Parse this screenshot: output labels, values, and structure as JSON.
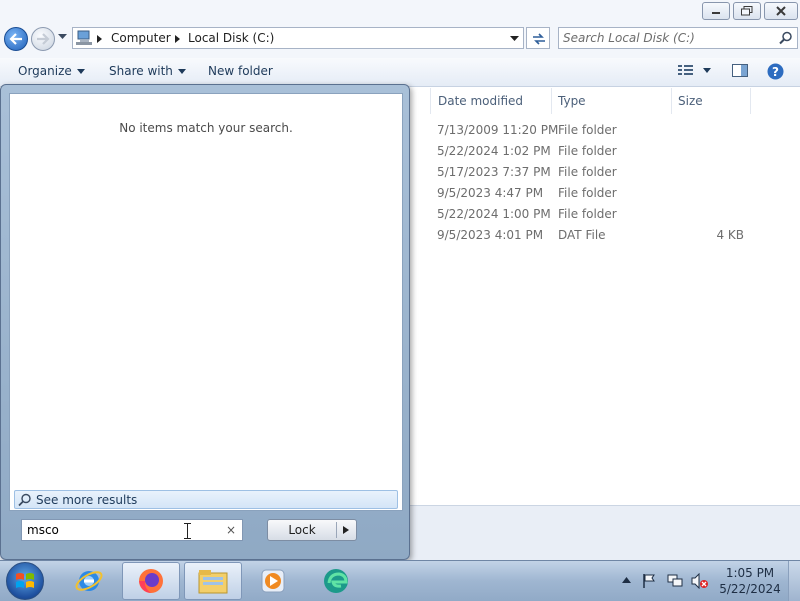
{
  "explorer": {
    "address": {
      "crumbs": [
        "Computer",
        "Local Disk (C:)"
      ]
    },
    "search": {
      "placeholder": "Search Local Disk (C:)"
    },
    "toolbar": {
      "organize_label": "Organize",
      "share_label": "Share with",
      "newfolder_label": "New folder"
    },
    "columns": {
      "date": "Date modified",
      "type": "Type",
      "size": "Size"
    },
    "rows": [
      {
        "date": "7/13/2009 11:20 PM",
        "type": "File folder",
        "size": ""
      },
      {
        "date": "5/22/2024 1:02 PM",
        "type": "File folder",
        "size": ""
      },
      {
        "date": "5/17/2023 7:37 PM",
        "type": "File folder",
        "size": ""
      },
      {
        "date": "9/5/2023 4:47 PM",
        "type": "File folder",
        "size": ""
      },
      {
        "date": "5/22/2024 1:00 PM",
        "type": "File folder",
        "size": ""
      },
      {
        "date": "9/5/2023 4:01 PM",
        "type": "DAT File",
        "size": "4 KB"
      }
    ]
  },
  "startmenu": {
    "no_results": "No items match your search.",
    "see_more": "See more results",
    "search_value": "msco",
    "clear_glyph": "×",
    "lock_label": "Lock"
  },
  "taskbar": {
    "pinned": [
      "ie-icon",
      "firefox-icon",
      "explorer-icon",
      "media-player-icon",
      "edge-icon"
    ],
    "clock": {
      "time": "1:05 PM",
      "date": "5/22/2024"
    }
  },
  "colors": {
    "accent": "#1d5fb8",
    "taskbar": "#9fb6d1",
    "startmenu_frame": "#a9c0d8"
  }
}
